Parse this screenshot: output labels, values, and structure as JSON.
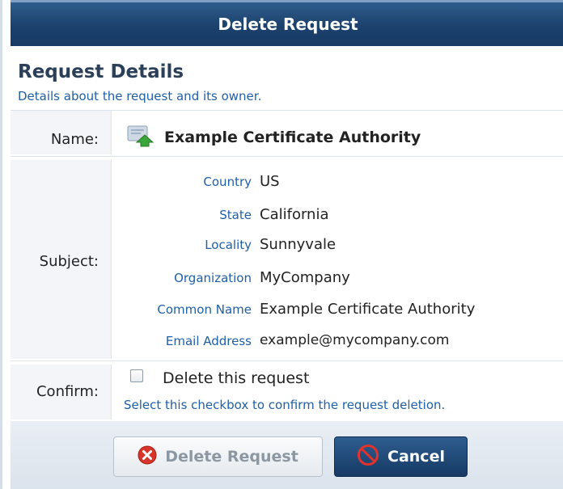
{
  "dialog": {
    "title": "Delete Request"
  },
  "section": {
    "title": "Request Details",
    "subtitle": "Details about the request and its owner."
  },
  "name_row": {
    "label": "Name:",
    "value": "Example Certificate Authority",
    "icon": "certificate-icon"
  },
  "subject_row": {
    "label": "Subject:",
    "fields": [
      {
        "key": "Country",
        "value": "US"
      },
      {
        "key": "State",
        "value": "California"
      },
      {
        "key": "Locality",
        "value": "Sunnyvale"
      },
      {
        "key": "Organization",
        "value": "MyCompany"
      },
      {
        "key": "Common Name",
        "value": "Example Certificate Authority"
      },
      {
        "key": "Email Address",
        "value": "example@mycompany.com"
      }
    ]
  },
  "confirm_row": {
    "label": "Confirm:",
    "checkbox_label": "Delete this request",
    "checked": false,
    "hint": "Select this checkbox to confirm the request deletion."
  },
  "buttons": {
    "delete_label": "Delete Request",
    "delete_icon": "delete-x-icon",
    "cancel_label": "Cancel",
    "cancel_icon": "cancel-icon"
  },
  "colors": {
    "header": "#1c416c",
    "link_blue": "#1f5fa8",
    "delete_red": "#d9342b"
  }
}
